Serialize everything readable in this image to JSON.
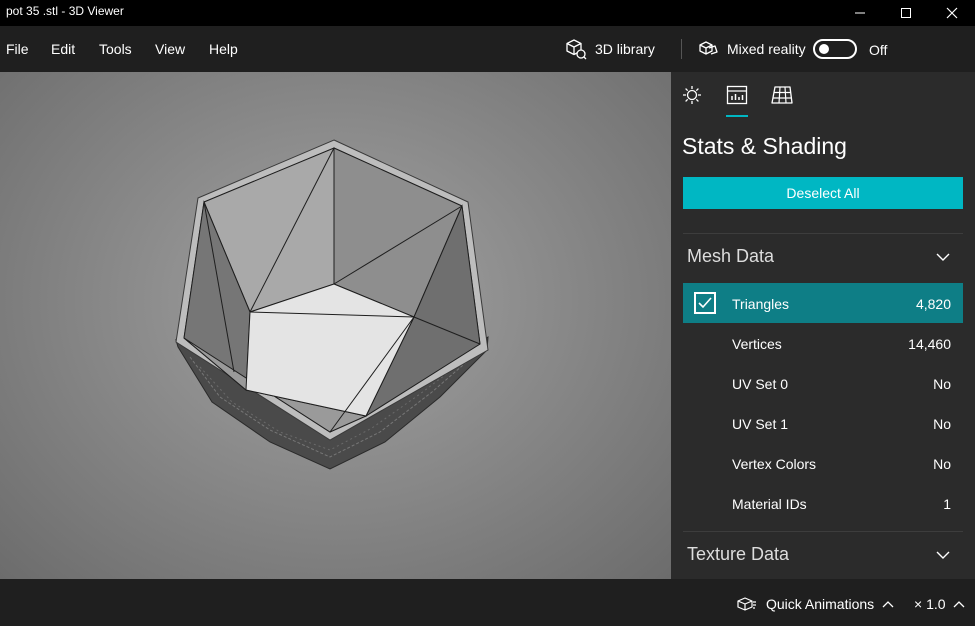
{
  "window": {
    "title": "pot 35 .stl - 3D Viewer"
  },
  "menu": {
    "items": [
      "File",
      "Edit",
      "Tools",
      "View",
      "Help"
    ],
    "library_label": "3D library",
    "mixed_reality_label": "Mixed reality",
    "mixed_reality_state": "Off"
  },
  "icons": {
    "tabs": [
      "lighting-icon",
      "stats-icon",
      "grid-icon"
    ],
    "library": "cube-icon",
    "mixed_reality": "mixed-reality-icon",
    "quick_animations": "animation-icon"
  },
  "panel": {
    "title": "Stats & Shading",
    "deselect_label": "Deselect All",
    "mesh_section": "Mesh Data",
    "texture_section": "Texture Data",
    "rows": [
      {
        "label": "Triangles",
        "value": "4,820",
        "checked": true
      },
      {
        "label": "Vertices",
        "value": "14,460"
      },
      {
        "label": "UV Set 0",
        "value": "No"
      },
      {
        "label": "UV Set 1",
        "value": "No"
      },
      {
        "label": "Vertex Colors",
        "value": "No"
      },
      {
        "label": "Material IDs",
        "value": "1"
      }
    ]
  },
  "bottom": {
    "quick_animations_label": "Quick Animations",
    "speed_label": "× 1.0"
  },
  "colors": {
    "accent": "#00b7c3",
    "selected_row": "#0e7e86",
    "panel_bg": "#2b2b2b",
    "chrome_bg": "#1f1f1f"
  }
}
